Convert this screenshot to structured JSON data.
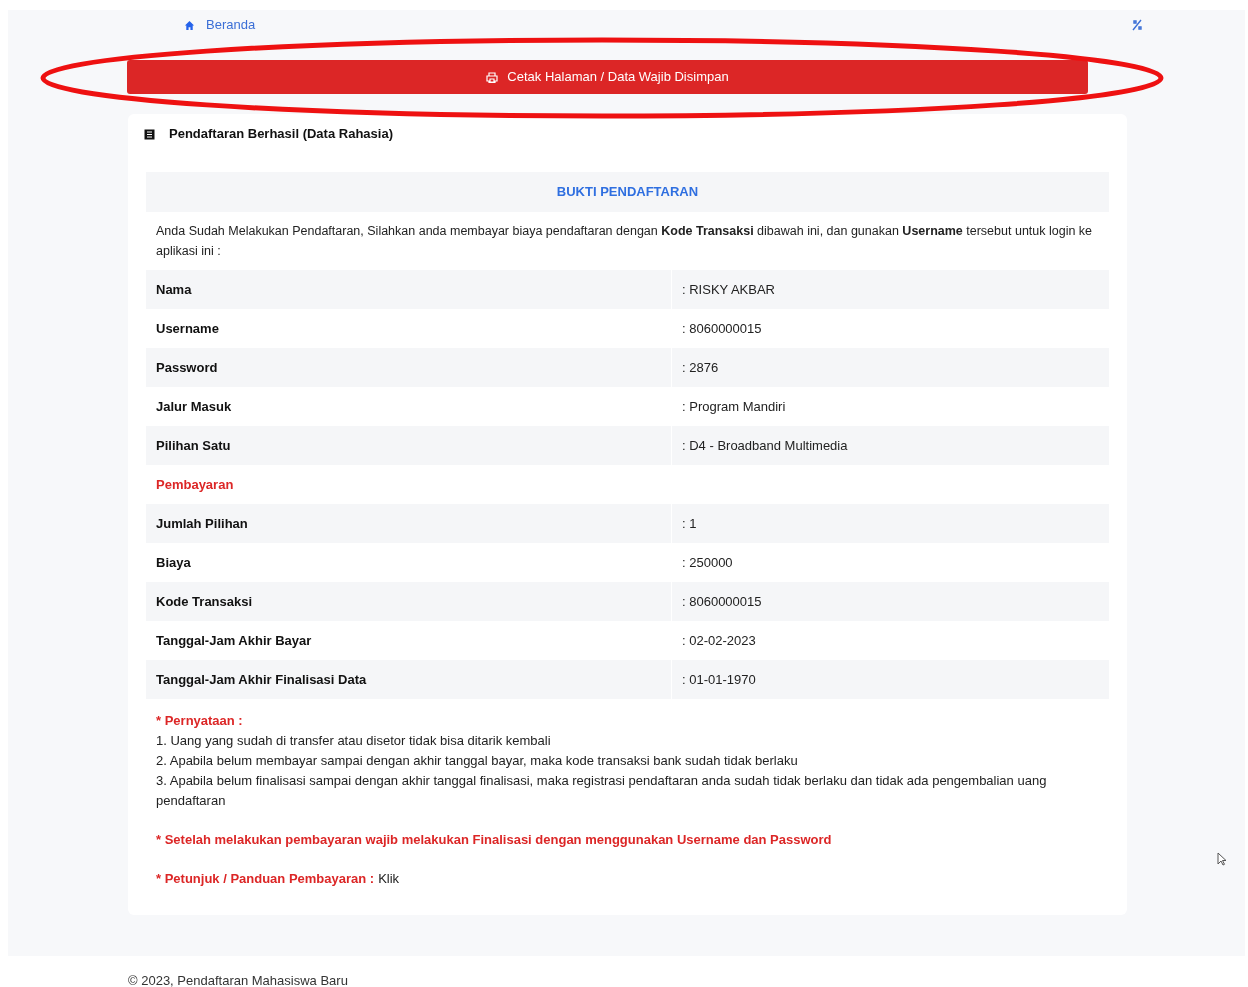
{
  "breadcrumb": {
    "label": "Beranda"
  },
  "print_button": {
    "label": "Cetak Halaman / Data Wajib Disimpan"
  },
  "card": {
    "title": "Pendaftaran Berhasil (Data Rahasia)",
    "heading": "BUKTI PENDAFTARAN",
    "intro": "Anda Sudah Melakukan Pendaftaran, Silahkan anda membayar biaya pendaftaran dengan **Kode Transaksi** dibawah ini, dan gunakan **Username** tersebut untuk login ke aplikasi ini :",
    "rows": [
      {
        "kind": "field",
        "label": "Nama",
        "value": ": RISKY AKBAR"
      },
      {
        "kind": "field",
        "label": "Username",
        "value": ": 8060000015"
      },
      {
        "kind": "field",
        "label": "Password",
        "value": ": 2876"
      },
      {
        "kind": "field",
        "label": "Jalur Masuk",
        "value": ": Program Mandiri"
      },
      {
        "kind": "field",
        "label": "Pilihan Satu",
        "value": ": D4 - Broadband Multimedia"
      },
      {
        "kind": "section",
        "label": "Pembayaran"
      },
      {
        "kind": "field",
        "label": "Jumlah Pilihan",
        "value": ": 1"
      },
      {
        "kind": "field",
        "label": "Biaya",
        "value": ": 250000"
      },
      {
        "kind": "field",
        "label": "Kode Transaksi",
        "value": ": 8060000015"
      },
      {
        "kind": "field",
        "label": "Tanggal-Jam Akhir Bayar",
        "value": ": 02-02-2023"
      },
      {
        "kind": "field",
        "label": "Tanggal-Jam Akhir Finalisasi Data",
        "value": ": 01-01-1970"
      }
    ],
    "statement_title": "* Pernyataan :",
    "statements": [
      "1. Uang yang sudah di transfer atau disetor tidak bisa ditarik kembali",
      "2. Apabila belum membayar sampai dengan akhir tanggal bayar, maka kode transaksi bank sudah tidak berlaku",
      "3. Apabila belum finalisasi sampai dengan akhir tanggal finalisasi, maka registrasi pendaftaran anda sudah tidak berlaku dan tidak ada pengembalian uang pendaftaran"
    ],
    "notice": "* Setelah melakukan pembayaran wajib melakukan Finalisasi dengan menggunakan Username dan Password",
    "guide_label": "* Petunjuk / Panduan Pembayaran :",
    "guide_link": "Klik"
  },
  "footer": "© 2023, Pendaftaran Mahasiswa Baru"
}
